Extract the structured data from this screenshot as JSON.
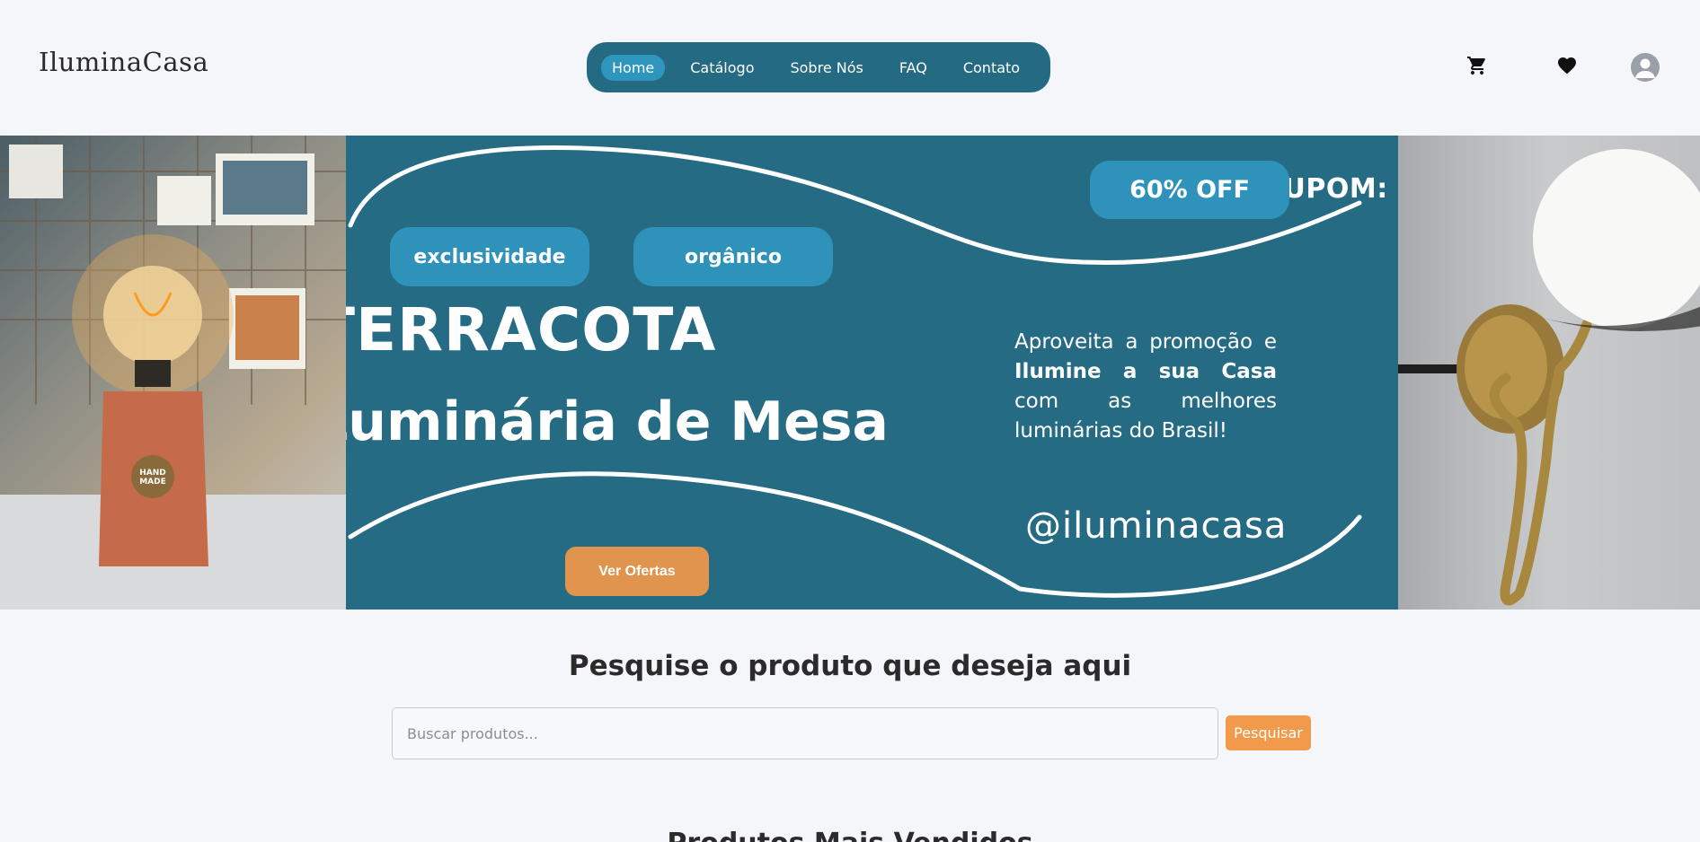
{
  "header": {
    "logo": "IluminaCasa",
    "nav": [
      "Home",
      "Catálogo",
      "Sobre Nós",
      "FAQ",
      "Contato"
    ],
    "icons": [
      "cart-icon",
      "heart-icon",
      "user-icon"
    ]
  },
  "hero": {
    "tags": [
      "exclusividade",
      "orgânico"
    ],
    "cupom_label": "CUPOM:",
    "cupom_value": "60% OFF",
    "title_line1": "TERRACOTA",
    "title_line2": "Luminária de Mesa",
    "promo_part1": "Aproveita a promoção e ",
    "promo_bold": "Ilumine a sua Casa",
    "promo_part2": " com as melhores luminárias do Brasil!",
    "handle": "@iluminacasa",
    "cta": "Ver Ofertas",
    "lamp_tag": "HAND MADE"
  },
  "search": {
    "title": "Pesquise o produto que deseja aqui",
    "placeholder": "Buscar produtos...",
    "button": "Pesquisar"
  },
  "best_sellers": {
    "title": "Produtos Mais Vendidos"
  },
  "colors": {
    "nav_bg": "#256a83",
    "nav_active": "#2e95bd",
    "banner_bg": "#256b84",
    "cta": "#e0944d",
    "search_button": "#f29a4b"
  }
}
